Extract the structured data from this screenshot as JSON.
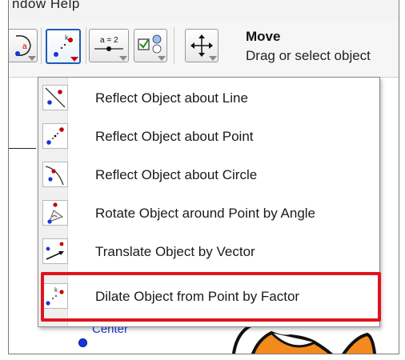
{
  "menubar": {
    "visible_text": "ndow  Help"
  },
  "toolbar": {
    "tool_title": "Move",
    "tool_description": "Drag or select object",
    "buttons": [
      {
        "icon": "circle-tool-icon"
      },
      {
        "icon": "dilate-icon",
        "active": true
      },
      {
        "icon": "slider-icon",
        "label": "a = 2"
      },
      {
        "icon": "checkbox-icon"
      },
      {
        "icon": "move-graphics-icon"
      }
    ]
  },
  "menu": {
    "items": [
      {
        "label": "Reflect Object about Line",
        "icon": "reflect-line-icon"
      },
      {
        "label": "Reflect Object about Point",
        "icon": "reflect-point-icon"
      },
      {
        "label": "Reflect Object about Circle",
        "icon": "reflect-circle-icon"
      },
      {
        "label": "Rotate Object around Point by Angle",
        "icon": "rotate-icon"
      },
      {
        "label": "Translate Object by Vector",
        "icon": "translate-icon"
      },
      {
        "label": "Dilate Object from Point by Factor",
        "icon": "dilate-icon",
        "highlighted": true
      }
    ]
  },
  "graphics": {
    "point_label": "Center"
  },
  "colors": {
    "highlight": "#e0141e",
    "point": "#1535e0",
    "active_border": "#1c5db8"
  }
}
